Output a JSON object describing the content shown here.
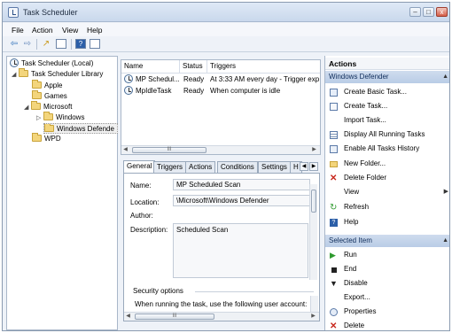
{
  "window": {
    "title": "Task Scheduler"
  },
  "window_buttons": {
    "minimize": "–",
    "maximize": "□",
    "close": "x"
  },
  "menu": [
    {
      "label": "File"
    },
    {
      "label": "Action"
    },
    {
      "label": "View"
    },
    {
      "label": "Help"
    }
  ],
  "tree": {
    "root": "Task Scheduler (Local)",
    "library": "Task Scheduler Library",
    "folders": [
      "Apple",
      "Games",
      "Microsoft",
      "Windows",
      "Windows Defende",
      "WPD"
    ]
  },
  "tasklist": {
    "columns": [
      "Name",
      "Status",
      "Triggers"
    ],
    "rows": [
      {
        "name": "MP Schedul...",
        "status": "Ready",
        "triggers": "At 3:33 AM every day - Trigger exp"
      },
      {
        "name": "MpIdleTask",
        "status": "Ready",
        "triggers": "When computer is idle"
      }
    ],
    "scroll_thumb": "III"
  },
  "tabs": [
    "General",
    "Triggers",
    "Actions",
    "Conditions",
    "Settings",
    "H"
  ],
  "general": {
    "name_label": "Name:",
    "name_value": "MP Scheduled Scan",
    "location_label": "Location:",
    "location_value": "\\Microsoft\\Windows Defender",
    "author_label": "Author:",
    "description_label": "Description:",
    "description_value": "Scheduled Scan",
    "security_group": "Security options",
    "security_text": "When running the task, use the following user account:",
    "scroll_thumb": "III"
  },
  "actions_pane": {
    "title": "Actions",
    "section1": "Windows Defender",
    "items1": [
      {
        "label": "Create Basic Task...",
        "icon": "wand-icon"
      },
      {
        "label": "Create Task...",
        "icon": "task-icon"
      },
      {
        "label": "Import Task...",
        "icon": "none"
      },
      {
        "label": "Display All Running Tasks",
        "icon": "list-icon"
      },
      {
        "label": "Enable All Tasks History",
        "icon": "history-icon"
      },
      {
        "label": "New Folder...",
        "icon": "folder-icon"
      },
      {
        "label": "Delete Folder",
        "icon": "delete-icon"
      },
      {
        "label": "View",
        "icon": "none"
      },
      {
        "label": "Refresh",
        "icon": "refresh-icon"
      },
      {
        "label": "Help",
        "icon": "help-icon"
      }
    ],
    "section2": "Selected Item",
    "items2": [
      {
        "label": "Run",
        "icon": "run-icon"
      },
      {
        "label": "End",
        "icon": "end-icon"
      },
      {
        "label": "Disable",
        "icon": "disable-icon"
      },
      {
        "label": "Export...",
        "icon": "none"
      },
      {
        "label": "Properties",
        "icon": "properties-icon"
      },
      {
        "label": "Delete",
        "icon": "delete-icon"
      }
    ]
  },
  "colors": {
    "selection": "#b9cce6",
    "accent": "#2c6fb8",
    "delete": "#c8271d",
    "run": "#2e9a2e"
  }
}
